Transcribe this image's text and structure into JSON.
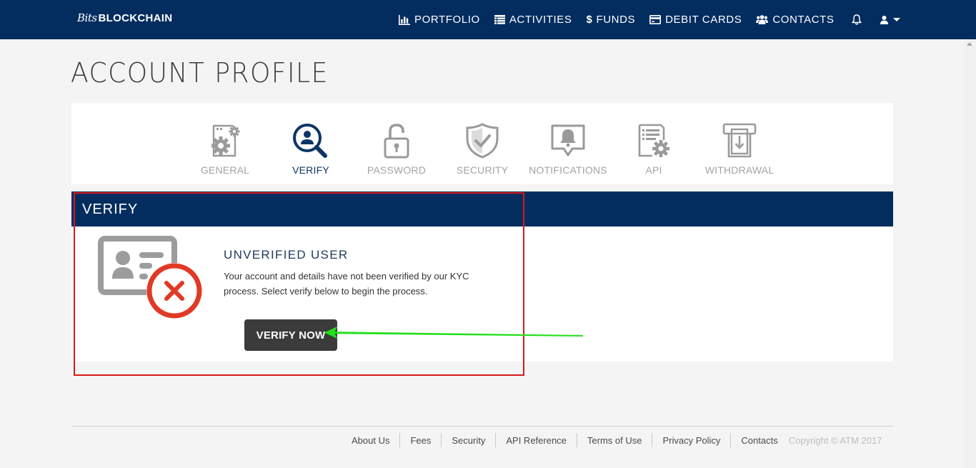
{
  "brand": {
    "script": "Bits",
    "name": "BLOCKCHAIN"
  },
  "nav": {
    "items": [
      {
        "label": "PORTFOLIO",
        "icon": "bar-chart-icon"
      },
      {
        "label": "ACTIVITIES",
        "icon": "list-icon"
      },
      {
        "label": "FUNDS",
        "icon": "dollar-icon"
      },
      {
        "label": "DEBIT CARDS",
        "icon": "credit-card-icon"
      },
      {
        "label": "CONTACTS",
        "icon": "users-icon"
      }
    ],
    "bell_icon": "bell-icon",
    "user_icon": "user-icon"
  },
  "page": {
    "title": "ACCOUNT PROFILE"
  },
  "tabs": [
    {
      "label": "GENERAL",
      "icon": "gears-document-icon",
      "active": false
    },
    {
      "label": "VERIFY",
      "icon": "user-search-icon",
      "active": true
    },
    {
      "label": "PASSWORD",
      "icon": "padlock-icon",
      "active": false
    },
    {
      "label": "SECURITY",
      "icon": "shield-check-icon",
      "active": false
    },
    {
      "label": "NOTIFICATIONS",
      "icon": "bell-chat-icon",
      "active": false
    },
    {
      "label": "API",
      "icon": "document-gear-icon",
      "active": false
    },
    {
      "label": "WITHDRAWAL",
      "icon": "atm-withdrawal-icon",
      "active": false
    }
  ],
  "verify": {
    "header": "VERIFY",
    "status_title": "UNVERIFIED USER",
    "status_text": "Your account and details have not been verified by our KYC process. Select verify below to begin the process.",
    "button_label": "VERIFY NOW"
  },
  "footer": {
    "links": [
      "About Us",
      "Fees",
      "Security",
      "API Reference",
      "Terms of Use",
      "Privacy Policy",
      "Contacts"
    ],
    "copyright": "Copyright © ATM 2017"
  },
  "colors": {
    "navy": "#032d5f",
    "error_red": "#e03a26",
    "annotation_red": "#d8191a",
    "annotation_green": "#22e01a",
    "icon_gray": "#9a9a9a"
  }
}
